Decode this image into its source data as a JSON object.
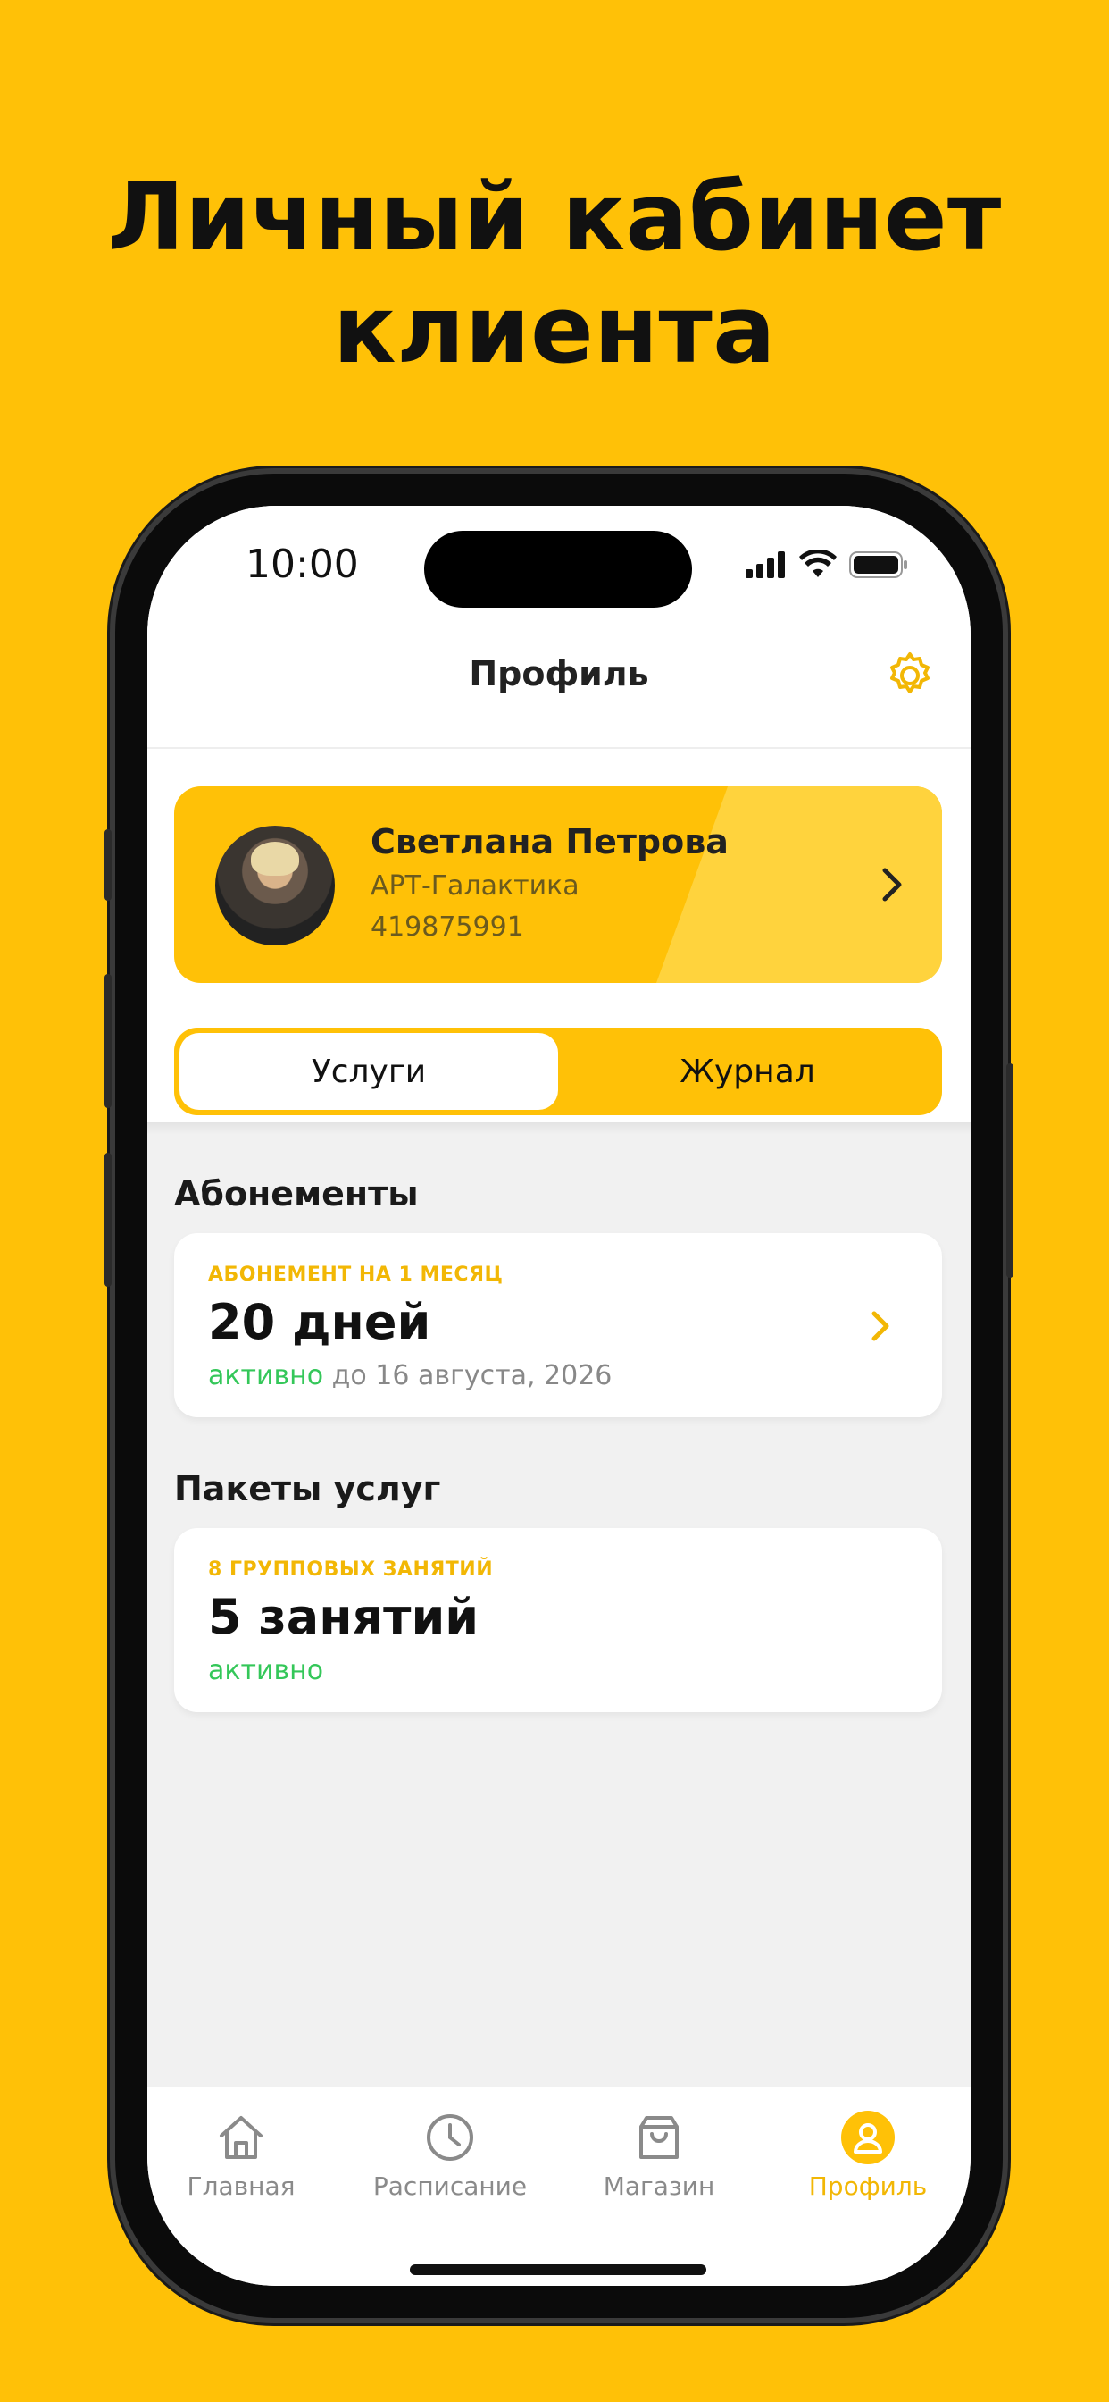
{
  "headline": {
    "line1": "Личный кабинет",
    "line2": "клиента"
  },
  "status_bar": {
    "time": "10:00"
  },
  "nav": {
    "title": "Профиль"
  },
  "profile": {
    "name": "Светлана Петрова",
    "club": "АРТ-Галактика",
    "id": "419875991"
  },
  "segmented": {
    "options": [
      "Услуги",
      "Журнал"
    ],
    "selected": "Услуги"
  },
  "subscriptions": {
    "title": "Абонементы",
    "card": {
      "kicker": "АБОНЕМЕНТ НА 1 МЕСЯЦ",
      "value": "20 дней",
      "status": "активно",
      "until": " до 16 августа, 2026"
    }
  },
  "packages": {
    "title": "Пакеты услуг",
    "card": {
      "kicker": "8 ГРУППОВЫХ ЗАНЯТИЙ",
      "value": "5 занятий",
      "status": "активно"
    }
  },
  "tabbar": {
    "items": [
      {
        "label": "Главная",
        "icon": "home-icon"
      },
      {
        "label": "Расписание",
        "icon": "clock-icon"
      },
      {
        "label": "Магазин",
        "icon": "bag-icon"
      },
      {
        "label": "Профиль",
        "icon": "profile-icon"
      }
    ],
    "active": "Профиль"
  },
  "colors": {
    "accent": "#FFC107",
    "accent_text": "#F2B705",
    "active_green": "#34C759",
    "screen_bg": "#F1F1F1"
  }
}
